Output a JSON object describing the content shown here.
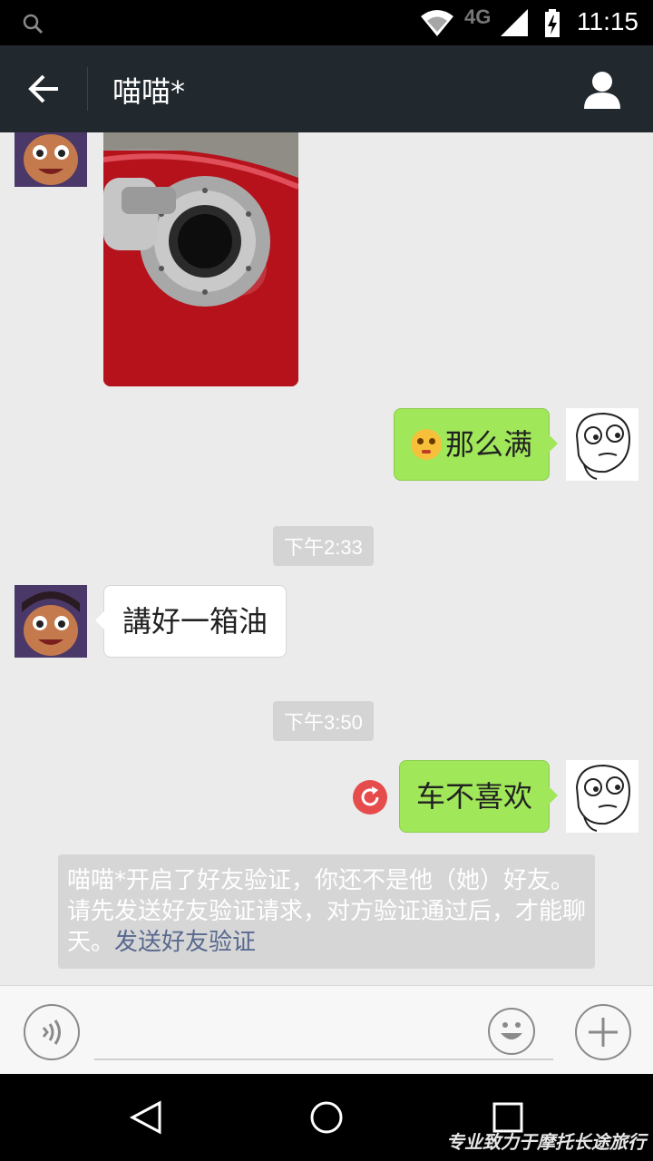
{
  "status_bar": {
    "network": "4G",
    "time": "11:15"
  },
  "header": {
    "title": "喵喵*"
  },
  "messages": {
    "m2_text": "那么满",
    "t1": "下午2:33",
    "m3_text": "講好一箱油",
    "t2": "下午3:50",
    "m4_text": "车不喜欢"
  },
  "notice": {
    "text": "喵喵*开启了好友验证，你还不是他（她）好友。请先发送好友验证请求，对方验证通过后，才能聊天。",
    "link": "发送好友验证"
  },
  "watermark": "专业致力于摩托长途旅行",
  "colors": {
    "header_bg": "#22292e",
    "green_bubble": "#a0e75a",
    "resend_icon": "#e64c4c",
    "link": "#58698f"
  }
}
